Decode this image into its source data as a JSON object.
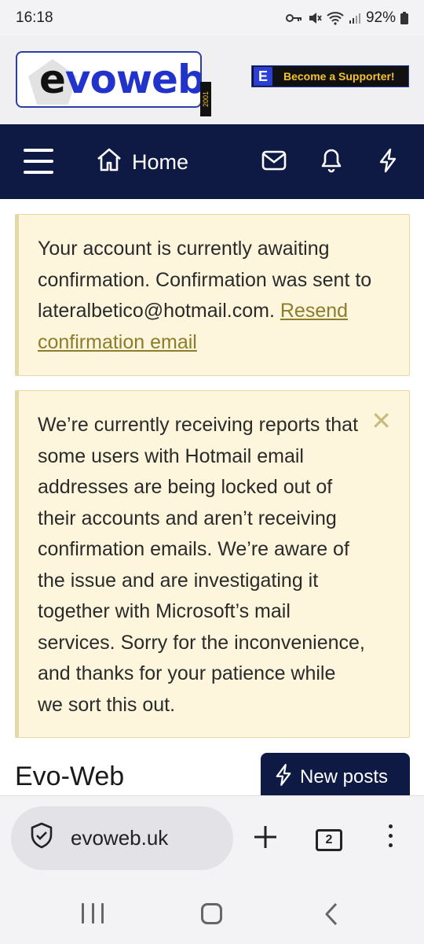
{
  "status_bar": {
    "time": "16:18",
    "battery": "92%"
  },
  "header": {
    "logo_text_e": "e",
    "logo_text_rest": "voweb",
    "logo_year": "2001",
    "supporter_badge": "E",
    "supporter_label": "Become a Supporter!"
  },
  "nav": {
    "home_label": "Home",
    "icons": [
      "menu-icon",
      "home-icon",
      "mail-icon",
      "bell-icon",
      "bolt-icon"
    ]
  },
  "notices": [
    {
      "text": "Your account is currently awaiting confirmation. Confirmation was sent to lateralbetico@hotmail.com.",
      "link_label": "Resend confirmation email"
    },
    {
      "text": "We’re currently receiving reports that some users with Hotmail email addresses are being locked out of their accounts and aren’t receiving confirmation emails. We’re aware of the issue and are investigating it together with Microsoft’s mail services. Sorry for the inconvenience, and thanks for your patience while we sort this out.",
      "close_label": "✕"
    }
  ],
  "section": {
    "title": "Evo-Web",
    "new_posts_label": "New posts"
  },
  "browser": {
    "url": "evoweb.uk",
    "tab_count": "2"
  },
  "colors": {
    "nav_bg": "#0e1a44",
    "notice_bg": "#fdf6dc",
    "link": "#8c7c2c",
    "brand_blue": "#2233cc"
  }
}
